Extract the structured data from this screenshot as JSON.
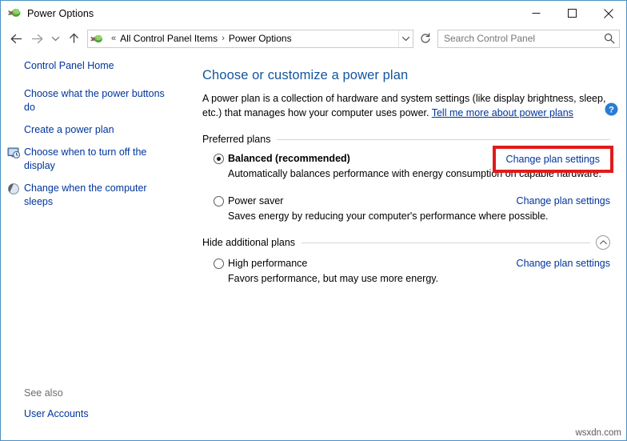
{
  "window": {
    "title": "Power Options",
    "icon": "power-plug-icon",
    "controls": {
      "minimize": "minimize-button",
      "maximize": "maximize-button",
      "close": "close-button"
    }
  },
  "navigation": {
    "back": "back-arrow-icon",
    "forward": "forward-arrow-icon",
    "recent": "chevron-down-icon",
    "up": "up-arrow-icon",
    "breadcrumb": {
      "icon": "power-plug-icon",
      "prefix": "«",
      "items": [
        "All Control Panel Items",
        "Power Options"
      ],
      "separator": "›",
      "dropdown": "chevron-down-icon"
    },
    "refresh": "refresh-icon"
  },
  "search": {
    "placeholder": "Search Control Panel",
    "icon": "search-icon"
  },
  "sidebar": {
    "items": [
      {
        "label": "Control Panel Home",
        "icon": null
      },
      {
        "label": "Choose what the power buttons do",
        "icon": null
      },
      {
        "label": "Create a power plan",
        "icon": null
      },
      {
        "label": "Choose when to turn off the display",
        "icon": "monitor-clock-icon"
      },
      {
        "label": "Change when the computer sleeps",
        "icon": "moon-sleep-icon"
      }
    ],
    "see_also": {
      "title": "See also",
      "links": [
        "User Accounts"
      ]
    }
  },
  "main": {
    "help_icon": "help-question-icon",
    "title": "Choose or customize a power plan",
    "description_part1": "A power plan is a collection of hardware and system settings (like display brightness, sleep, etc.) that manages how your computer uses power. ",
    "description_link": "Tell me more about power plans",
    "sections": [
      {
        "label": "Preferred plans",
        "collapse_icon": null,
        "plans": [
          {
            "name": "Balanced (recommended)",
            "selected": true,
            "bold": true,
            "description": "Automatically balances performance with energy consumption on capable hardware.",
            "action": "Change plan settings",
            "highlighted": true
          },
          {
            "name": "Power saver",
            "selected": false,
            "bold": false,
            "description": "Saves energy by reducing your computer's performance where possible.",
            "action": "Change plan settings",
            "highlighted": false
          }
        ]
      },
      {
        "label": "Hide additional plans",
        "collapse_icon": "chevron-up-circle-icon",
        "plans": [
          {
            "name": "High performance",
            "selected": false,
            "bold": false,
            "description": "Favors performance, but may use more energy.",
            "action": "Change plan settings",
            "highlighted": false
          }
        ]
      }
    ]
  },
  "watermark": "wsxdn.com",
  "colors": {
    "link": "#00349c",
    "title": "#14549e",
    "highlight_box": "#e01b1b",
    "window_border": "#4a90c4"
  }
}
